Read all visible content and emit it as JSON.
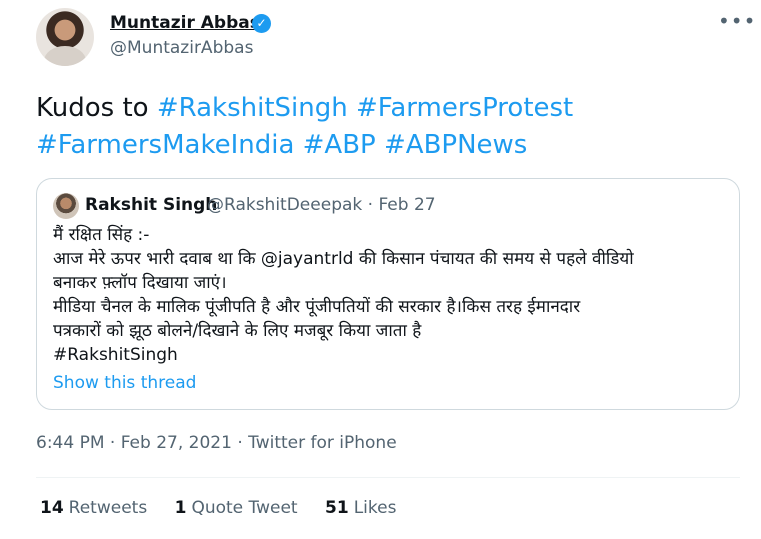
{
  "author": {
    "name": "Muntazir Abbas",
    "handle": "@MuntazirAbbas",
    "verified_glyph": "✓",
    "more_glyph": "•••"
  },
  "tweet": {
    "prefix": "Kudos to ",
    "hashtags": [
      "#RakshitSingh",
      "#FarmersProtest",
      "#FarmersMakeIndia",
      "#ABP",
      "#ABPNews"
    ]
  },
  "quote": {
    "name": "Rakshit Singh",
    "meta": "@RakshitDeeepak · Feb 27",
    "lines": [
      "मैं रक्षित सिंह :-",
      "आज मेरे ऊपर भारी दवाब था कि @jayantrld की किसान पंचायत की समय से पहले वीडियो",
      "बनाकर फ़्लॉप दिखाया जाएं।",
      "मीडिया चैनल के मालिक पूंजीपति है और पूंजीपतियों की सरकार है।किस तरह ईमानदार",
      "पत्रकारों को झूठ बोलने/दिखाने के लिए मजबूर किया जाता है",
      "#RakshitSingh"
    ],
    "show_thread": "Show this thread"
  },
  "timestamp": "6:44 PM · Feb 27, 2021 · Twitter for iPhone",
  "stats": {
    "retweets_count": "14",
    "retweets_label": "Retweets",
    "quotes_count": "1",
    "quotes_label": "Quote Tweet",
    "likes_count": "51",
    "likes_label": "Likes"
  },
  "colors": {
    "link": "#1d9bf0",
    "text": "#0f1419",
    "secondary": "#536471",
    "border": "#cfd9de"
  }
}
